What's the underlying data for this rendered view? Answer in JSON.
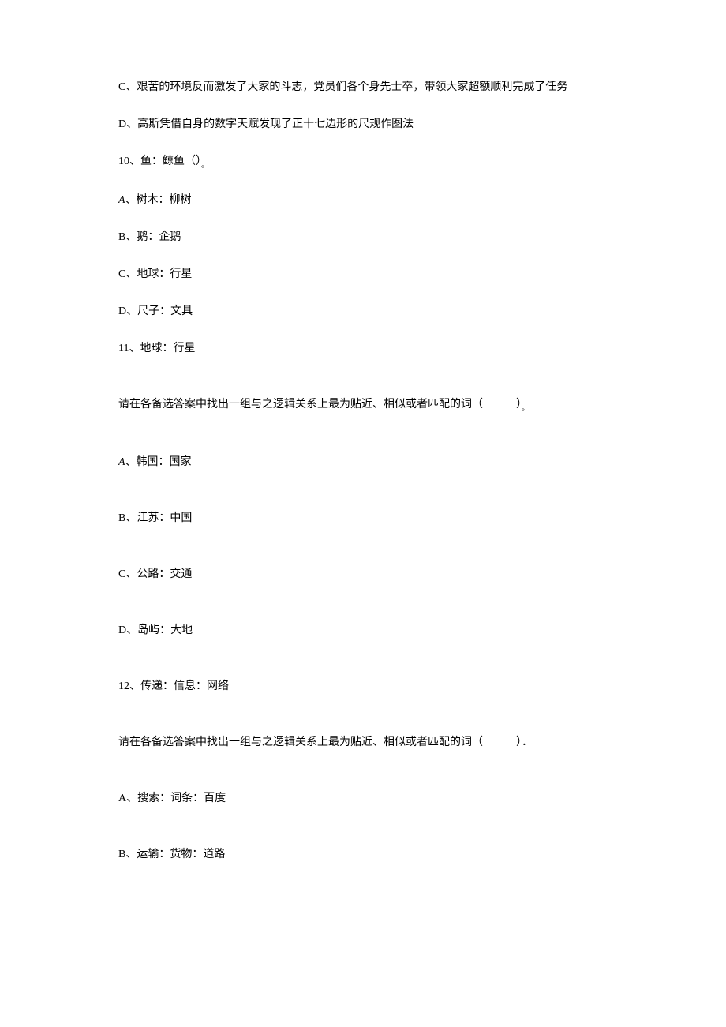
{
  "lines": {
    "c_prev": "C、艰苦的环境反而激发了大家的斗志，党员们各个身先士卒，带领大家超额顺利完成了任务",
    "d_prev": "D、高斯凭借自身的数字天赋发现了正十七边形的尺规作图法",
    "q10": "10、鱼：鲸鱼（）",
    "q10_sub": "。",
    "q10_a": "A",
    "q10_a_rest": "、树木：柳树",
    "q10_b": "B、鹅：企鹅",
    "q10_c": "C、地球：行星",
    "q10_d": "D、尺子：文具",
    "q11": "11、地球：行星",
    "q11_prompt": "请在各备选答案中找出一组与之逻辑关系上最为贴近、相似或者匹配的词（　　　）",
    "q11_sub": "。",
    "q11_a": "A",
    "q11_a_rest": "、韩国：国家",
    "q11_b": "B、江苏：中国",
    "q11_c": "C、公路：交通",
    "q11_d": "D、岛屿：大地",
    "q12": "12、传递：信息：网络",
    "q12_prompt": "请在各备选答案中找出一组与之逻辑关系上最为贴近、相似或者匹配的词（　　　）．",
    "q12_a": "A、搜索：词条：百度",
    "q12_b": "B、运输：货物：道路"
  }
}
